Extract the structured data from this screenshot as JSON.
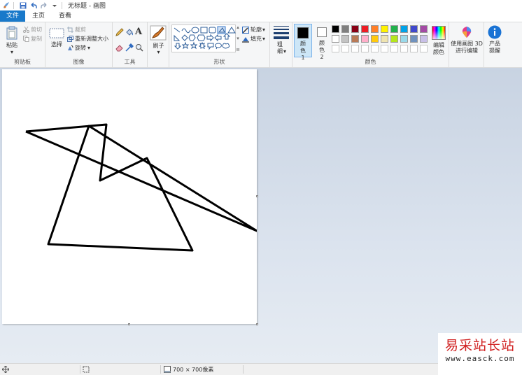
{
  "titlebar": {
    "doc_title": "无标题 - 画图",
    "icons": [
      "paint-app-icon",
      "save-icon",
      "undo-icon",
      "redo-icon",
      "customize-dropdown-icon"
    ]
  },
  "tabs": [
    {
      "label": "文件",
      "active": false
    },
    {
      "label": "主页",
      "active": true
    },
    {
      "label": "查看",
      "active": false
    }
  ],
  "ribbon": {
    "clipboard": {
      "label": "剪贴板",
      "paste": "粘贴",
      "cut": "剪切",
      "copy": "复制"
    },
    "image": {
      "label": "图像",
      "select": "选择",
      "crop": "裁剪",
      "resize": "重新调整大小",
      "rotate": "旋转"
    },
    "tools": {
      "label": "工具",
      "items": [
        "pencil-icon",
        "fill-icon",
        "text-icon",
        "eraser-icon",
        "color-picker-icon",
        "magnifier-icon"
      ]
    },
    "brushes": {
      "label": "刷子"
    },
    "shapes": {
      "label": "形状",
      "outline": "轮廓",
      "fill": "填充"
    },
    "size": {
      "label": "粗细"
    },
    "colors": {
      "label": "颜色",
      "color1": "颜色 1",
      "color2": "颜色 2",
      "edit": "编辑颜色",
      "row1": [
        "#000000",
        "#7f7f7f",
        "#880015",
        "#ed1c24",
        "#ff7f27",
        "#fff200",
        "#22b14c",
        "#00a2e8",
        "#3f48cc",
        "#a349a4"
      ],
      "row2": [
        "#ffffff",
        "#c3c3c3",
        "#b97a57",
        "#ffaec9",
        "#ffc90e",
        "#efe4b0",
        "#b5e61d",
        "#99d9ea",
        "#7092be",
        "#c8bfe7"
      ],
      "color1_value": "#000000",
      "color2_value": "#ffffff"
    },
    "paint3d": {
      "label": "使用画图 3D 进行编辑"
    },
    "product": {
      "label": "产品提醒"
    }
  },
  "statusbar": {
    "canvas_size": "700 × 700像素"
  },
  "watermark": {
    "title": "易采站长站",
    "url": "www.easck.com"
  }
}
